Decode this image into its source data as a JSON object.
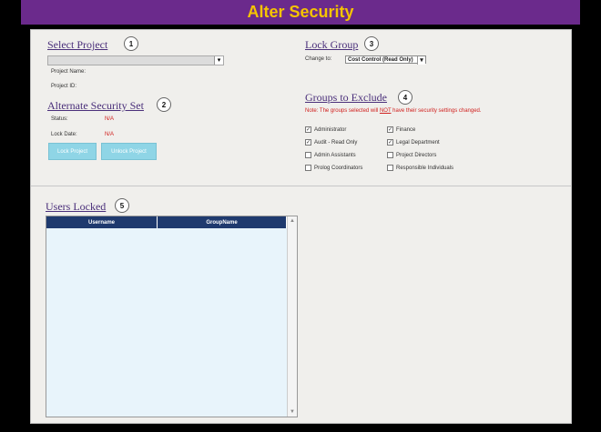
{
  "header": {
    "title": "Alter Security"
  },
  "select_project": {
    "title": "Select Project",
    "badge": "1",
    "dropdown_value": "",
    "project_name_label": "Project Name:",
    "project_id_label": "Project ID:"
  },
  "alt_security": {
    "title": "Alternate Security Set",
    "badge": "2",
    "status_label": "Status:",
    "status_value": "N/A",
    "lock_date_label": "Lock Date:",
    "lock_date_value": "N/A",
    "lock_button": "Lock Project",
    "unlock_button": "Unlock Project"
  },
  "lock_group": {
    "title": "Lock Group",
    "badge": "3",
    "change_to_label": "Change to:",
    "selected": "Cost Control (Read Only)"
  },
  "groups_exclude": {
    "title": "Groups to Exclude",
    "badge": "4",
    "note_prefix": "Note: The groups selected will ",
    "note_emph": "NOT",
    "note_suffix": " have their security settings changed.",
    "items": [
      {
        "label": "Administrator",
        "checked": true
      },
      {
        "label": "Finance",
        "checked": true
      },
      {
        "label": "Audit - Read Only",
        "checked": true
      },
      {
        "label": "Legal Department",
        "checked": true
      },
      {
        "label": "Admin Assistants",
        "checked": false
      },
      {
        "label": "Project Directors",
        "checked": false
      },
      {
        "label": "Prolog Coordinators",
        "checked": false
      },
      {
        "label": "Responsible Individuals",
        "checked": false
      }
    ]
  },
  "users_locked": {
    "title": "Users Locked",
    "badge": "5",
    "columns": [
      "Username",
      "GroupName"
    ],
    "rows": []
  }
}
